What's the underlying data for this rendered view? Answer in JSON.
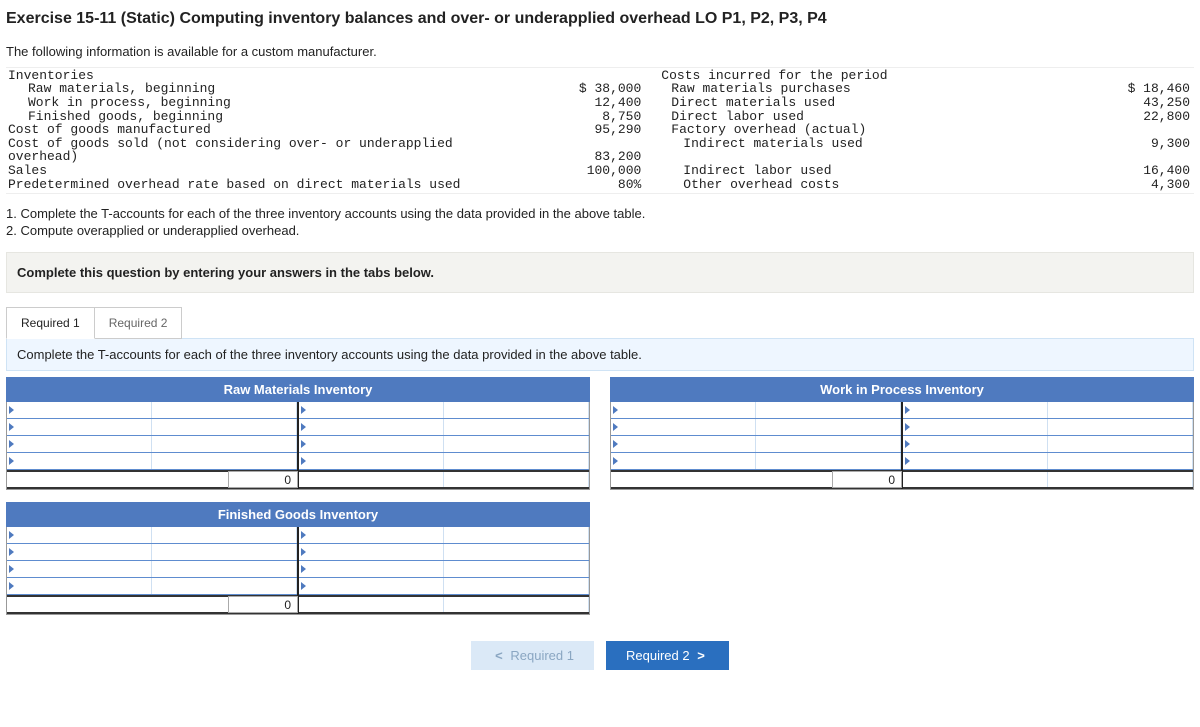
{
  "title": "Exercise 15-11 (Static) Computing inventory balances and over- or underapplied overhead LO P1, P2, P3, P4",
  "intro": "The following information is available for a custom manufacturer.",
  "left_header": "Inventories",
  "right_header": "Costs incurred for the period",
  "left_rows": [
    {
      "label": "Raw materials, beginning",
      "indent": true,
      "value": "$ 38,000"
    },
    {
      "label": "Work in process, beginning",
      "indent": true,
      "value": "12,400"
    },
    {
      "label": "Finished goods, beginning",
      "indent": true,
      "value": "8,750"
    },
    {
      "label": "Cost of goods manufactured",
      "indent": false,
      "value": "95,290"
    },
    {
      "label": "Cost of goods sold (not considering over- or underapplied overhead)",
      "indent": false,
      "value": "83,200"
    },
    {
      "label": "Sales",
      "indent": false,
      "value": "100,000"
    },
    {
      "label": "Predetermined overhead rate based on direct materials used",
      "indent": false,
      "value": "80%"
    }
  ],
  "right_rows": [
    {
      "label": "Raw materials purchases",
      "value": "$ 18,460"
    },
    {
      "label": "Direct materials used",
      "value": "43,250"
    },
    {
      "label": "Direct labor used",
      "value": "22,800"
    },
    {
      "label": "Factory overhead (actual)",
      "value": ""
    },
    {
      "label": "Indirect materials used",
      "indent": true,
      "value": "9,300"
    },
    {
      "label": "Indirect labor used",
      "indent": true,
      "value": "16,400"
    },
    {
      "label": "Other overhead costs",
      "indent": true,
      "value": "4,300"
    }
  ],
  "step1": "1. Complete the T-accounts for each of the three inventory accounts using the data provided in the above table.",
  "step2": "2. Compute overapplied or underapplied overhead.",
  "graybar": "Complete this question by entering your answers in the tabs below.",
  "tabs": {
    "t1": "Required 1",
    "t2": "Required 2"
  },
  "instr": "Complete the T-accounts for each of the three inventory accounts using the data provided in the above table.",
  "tacct_titles": {
    "rm": "Raw Materials Inventory",
    "wip": "Work in Process Inventory",
    "fg": "Finished Goods Inventory"
  },
  "zero": "0",
  "nav": {
    "prev": "Required 1",
    "next": "Required 2"
  }
}
